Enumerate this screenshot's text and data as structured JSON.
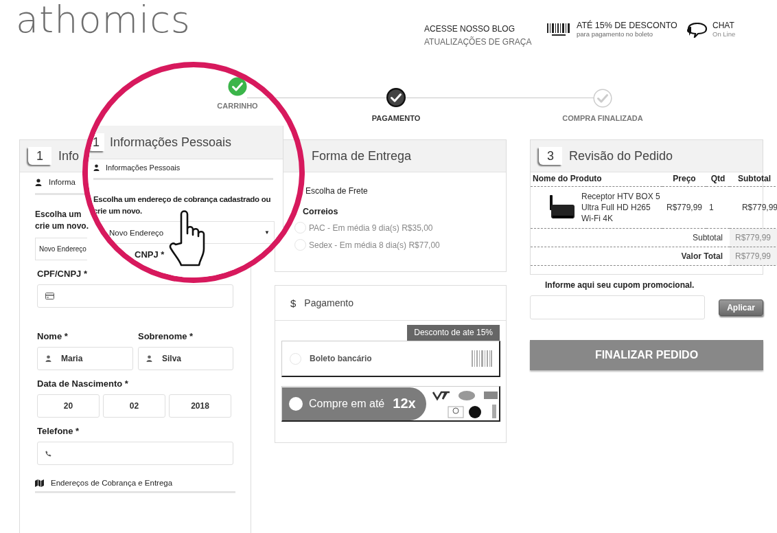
{
  "logo": "athomics",
  "header_links": [
    {
      "kind": "blog",
      "title": "ACESSE NOSSO BLOG",
      "subtitle": "ATUALIZAÇÕES DE GRAÇA"
    },
    {
      "kind": "boleto",
      "title": "ATÉ 15% DE DESCONTO",
      "subtitle": "para pagamento no boleto"
    },
    {
      "kind": "chat",
      "title": "CHAT",
      "subtitle": "On Line"
    }
  ],
  "steps": [
    {
      "label": "CARRINHO",
      "completed": true,
      "selected": false
    },
    {
      "label": "PAGAMENTO",
      "completed": false,
      "selected": true
    },
    {
      "label": "COMPRA FINALIZADA",
      "completed": false,
      "selected": false
    }
  ],
  "personal": {
    "number": "1",
    "title": "Info",
    "section": "Informa",
    "prompt_lines": [
      "Escolha um",
      "crie um novo."
    ],
    "address_select": "Novo Endereço",
    "document_label": "CPF/CNPJ *",
    "name_label": "Nome *",
    "name_value": "Maria",
    "surname_label": "Sobrenome *",
    "surname_value": "Silva",
    "birth_label": "Data de Nascimento *",
    "birth": [
      "20",
      "02",
      "2018"
    ],
    "phone_label": "Telefone *",
    "addresses_section": "Endereços de Cobrança e Entrega"
  },
  "magnifier": {
    "number": "1",
    "title": "Informações Pessoais",
    "section": "Informações Pessoais",
    "prompt": "Escolha um endereço de cobrança cadastrado ou crie um novo.",
    "address_select": "Novo Endereço",
    "dropdown_arrow": "▼",
    "document_label": "CNPJ *"
  },
  "shipping": {
    "title": "Forma de Entrega",
    "prompt": "Escolha de Frete",
    "carrier": "Correios",
    "options": [
      {
        "label": "PAC - Em média 9 dia(s) R$35,00",
        "selected": false
      },
      {
        "label": "Sedex - Em média 8 dia(s) R$77,00",
        "selected": false
      }
    ]
  },
  "payment": {
    "icon": "$",
    "title": "Pagamento",
    "badge": "Desconto de ate 15%",
    "options": [
      {
        "kind": "boleto",
        "label": "Boleto bancário",
        "selected": false
      },
      {
        "kind": "card",
        "label": "Compre em até",
        "installments": "12x",
        "selected": false
      }
    ]
  },
  "review": {
    "number": "3",
    "title": "Revisão do Pedido",
    "columns": [
      "Nome do Produto",
      "Preço",
      "Qtd",
      "Subtotal"
    ],
    "items": [
      {
        "name": "Receptor HTV BOX 5 Ultra Full HD H265 Wi-Fi 4K",
        "price": "R$779,99",
        "qty": "1",
        "subtotal": "R$779,99"
      }
    ],
    "totals": [
      {
        "kind": "subtotal",
        "label": "Subtotal",
        "value": "R$779,99"
      },
      {
        "kind": "total",
        "label": "Valor Total",
        "value": "R$779,99"
      }
    ]
  },
  "coupon": {
    "label": "Informe aqui seu cupom promocional.",
    "button": "Aplicar"
  },
  "finish_button": "FINALIZAR PEDIDO"
}
